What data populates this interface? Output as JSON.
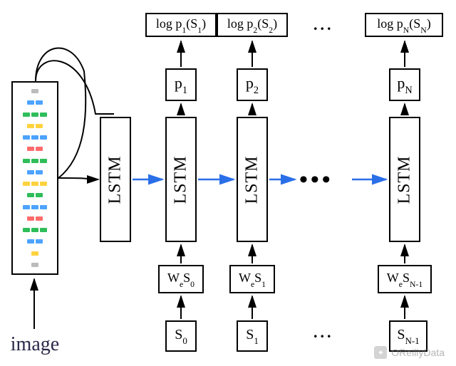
{
  "labels": {
    "image": "image",
    "lstm": "LSTM",
    "ellipsis_h": "•••",
    "ellipsis_top": "...",
    "ellipsis_bot": "..."
  },
  "columns": {
    "t1": {
      "logp": "log p₁(S₁)",
      "p": "p₁",
      "we": "WeS₀",
      "s": "S₀"
    },
    "t2": {
      "logp": "log p₂(S₂)",
      "p": "p₂",
      "we": "WeS₁",
      "s": "S₁"
    },
    "tN": {
      "logp": "log pN(SN)",
      "p": "pN",
      "we": "WeSN-1",
      "s": "SN-1"
    }
  },
  "watermark": "OReillyData",
  "colors": {
    "arrow_blue": "#2a6fe8",
    "arrow_black": "#000000"
  }
}
